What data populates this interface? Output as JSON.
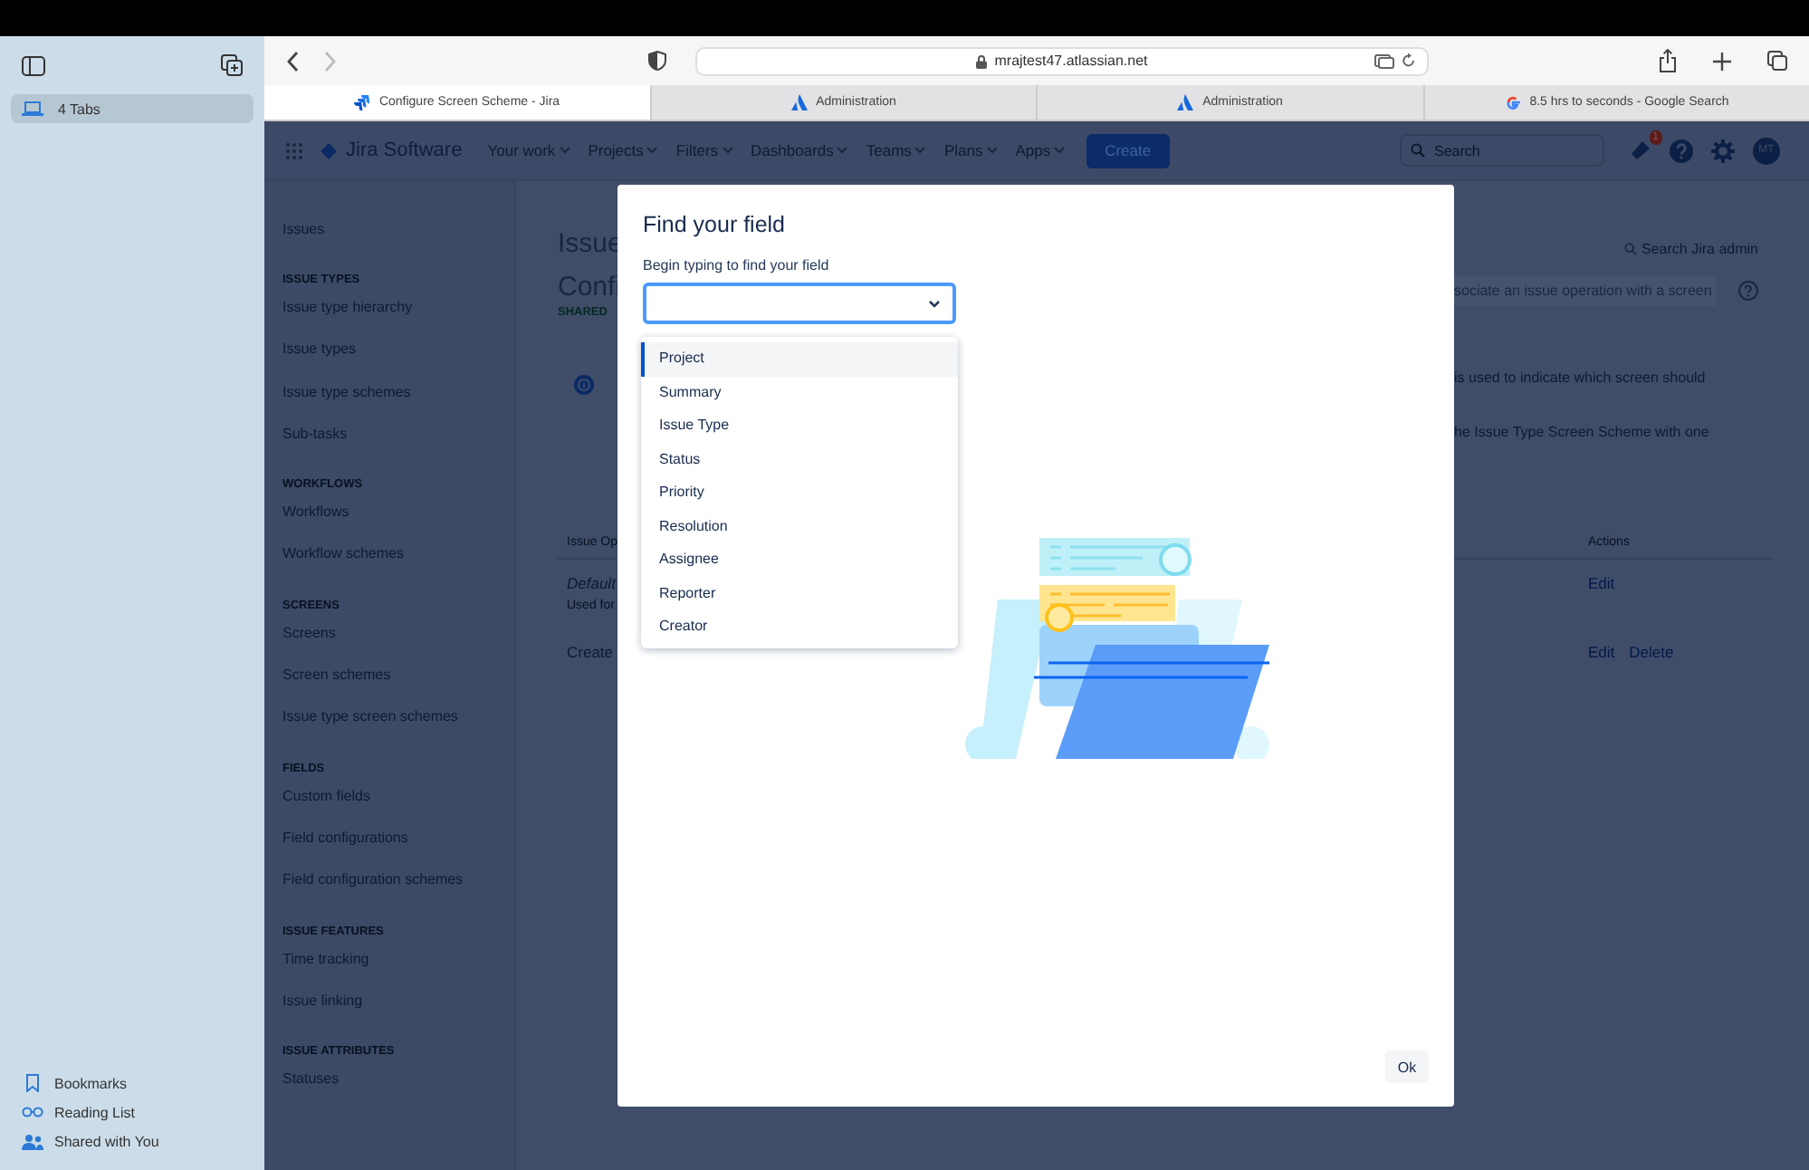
{
  "browser_sidebar": {
    "tab_groups": [
      {
        "label": "4 Tabs",
        "selected": true
      }
    ],
    "bottom_links": [
      {
        "label": "Bookmarks",
        "kind": "bookmark"
      },
      {
        "label": "Reading List",
        "kind": "reading"
      },
      {
        "label": "Shared with You",
        "kind": "shared"
      }
    ]
  },
  "address_bar": {
    "url": "mrajtest47.atlassian.net"
  },
  "tabs": [
    {
      "title": "Configure Screen Scheme - Jira",
      "selected": true,
      "kind": "jira"
    },
    {
      "title": "Administration",
      "selected": false,
      "kind": "atlassian"
    },
    {
      "title": "Administration",
      "selected": false,
      "kind": "atlassian"
    },
    {
      "title": "8.5 hrs to seconds - Google Search",
      "selected": false,
      "kind": "google"
    }
  ],
  "top_nav": {
    "product": "Jira Software",
    "menus": [
      "Your work",
      "Projects",
      "Filters",
      "Dashboards",
      "Teams",
      "Plans",
      "Apps"
    ],
    "create": "Create",
    "search_placeholder": "Search",
    "notification_count": "1",
    "avatar": "MT"
  },
  "admin_sidebar": {
    "title": "Issues",
    "sections": [
      {
        "heading": "ISSUE TYPES",
        "items": [
          "Issue type hierarchy",
          "Issue types",
          "Issue type schemes",
          "Sub-tasks"
        ]
      },
      {
        "heading": "WORKFLOWS",
        "items": [
          "Workflows",
          "Workflow schemes"
        ]
      },
      {
        "heading": "SCREENS",
        "items": [
          "Screens",
          "Screen schemes",
          "Issue type screen schemes"
        ]
      },
      {
        "heading": "FIELDS",
        "items": [
          "Custom fields",
          "Field configurations",
          "Field configuration schemes"
        ]
      },
      {
        "heading": "ISSUE FEATURES",
        "items": [
          "Time tracking",
          "Issue linking"
        ]
      },
      {
        "heading": "ISSUE ATTRIBUTES",
        "items": [
          "Statuses"
        ]
      }
    ]
  },
  "page": {
    "heading": "Issue",
    "search_admin": "Search Jira admin",
    "title": "Confi",
    "lozenge": "SHARED",
    "associate_button": "sociate an issue operation with a screen",
    "info_lines": [
      "is used to indicate which screen should",
      "he Issue Type Screen Scheme with one"
    ],
    "table": {
      "columns": [
        "Issue Op",
        "Actions"
      ],
      "rows": [
        {
          "name": "Default",
          "note": "Used for",
          "actions": [
            "Edit"
          ]
        },
        {
          "name": "Create",
          "actions": [
            "Edit",
            "Delete"
          ]
        }
      ]
    }
  },
  "dialog": {
    "title": "Find your field",
    "field_label": "Begin typing to find your field",
    "options": [
      {
        "label": "Project",
        "selected": true
      },
      {
        "label": "Summary",
        "selected": false
      },
      {
        "label": "Issue Type",
        "selected": false
      },
      {
        "label": "Status",
        "selected": false
      },
      {
        "label": "Priority",
        "selected": false
      },
      {
        "label": "Resolution",
        "selected": false
      },
      {
        "label": "Assignee",
        "selected": false
      },
      {
        "label": "Reporter",
        "selected": false
      },
      {
        "label": "Creator",
        "selected": false
      }
    ],
    "ok_button": "Ok"
  }
}
